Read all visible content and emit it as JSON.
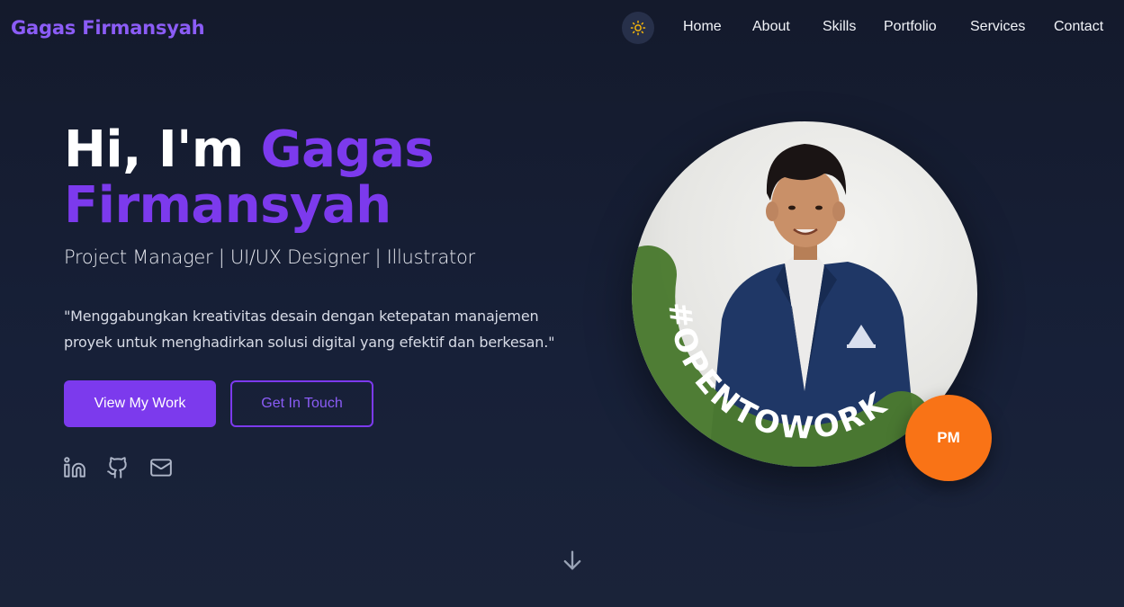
{
  "header": {
    "brand": "Gagas Firmansyah",
    "theme_toggle_icon": "sun-icon",
    "nav": [
      {
        "label": "Home"
      },
      {
        "label": "About"
      },
      {
        "label": "Skills"
      },
      {
        "label": "Portfolio"
      },
      {
        "label": "Services"
      },
      {
        "label": "Contact"
      }
    ]
  },
  "hero": {
    "greeting": "Hi, I'm ",
    "name_first": "Gagas",
    "name_last": "Firmansyah",
    "subtitle": "Project Manager | UI/UX Designer | Illustrator",
    "quote": "\"Menggabungkan kreativitas desain dengan ketepatan manajemen proyek untuk menghadirkan solusi digital yang efektif dan berkesan.\"",
    "primary_button": "View My Work",
    "secondary_button": "Get In Touch",
    "social": [
      {
        "icon": "linkedin-icon"
      },
      {
        "icon": "github-icon"
      },
      {
        "icon": "mail-icon"
      }
    ],
    "scroll_icon": "arrow-down-icon"
  },
  "profile": {
    "frame_text": "#OPENTOWORK",
    "badge": "PM"
  },
  "colors": {
    "accent": "#7c3aed",
    "background": "#141b2d",
    "badge": "#f97316",
    "frame": "#4a7a2f"
  }
}
